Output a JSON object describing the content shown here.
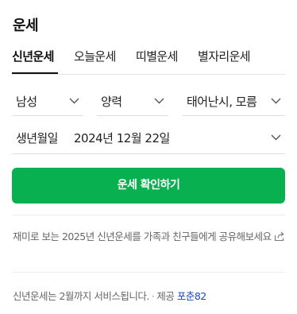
{
  "title": "운세",
  "tabs": [
    {
      "label": "신년운세",
      "active": true
    },
    {
      "label": "오늘운세",
      "active": false
    },
    {
      "label": "띠별운세",
      "active": false
    },
    {
      "label": "별자리운세",
      "active": false
    }
  ],
  "selects": {
    "gender": "남성",
    "calendar": "양력",
    "birth_time": "태어난시, 모름"
  },
  "birth": {
    "label": "생년월일",
    "value": "2024년 12월 22일"
  },
  "cta_label": "운세 확인하기",
  "share_text": "재미로 보는 2025년 신년운세를 가족과 친구들에게 공유해보세요",
  "footer": {
    "notice": "신년운세는 2월까지 서비스됩니다.",
    "provider_prefix": "제공",
    "provider": "포춘82",
    "dot": "·"
  },
  "colors": {
    "accent": "#08b050",
    "link": "#1a4bb8"
  }
}
